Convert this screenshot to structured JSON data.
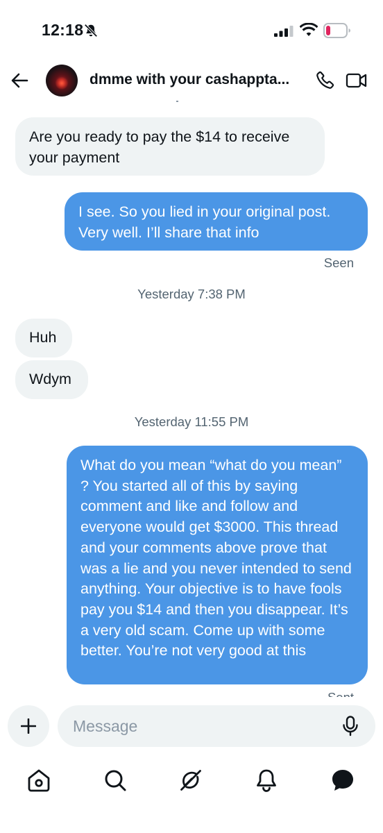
{
  "status_bar": {
    "time": "12:18",
    "icons": [
      "bell-off-icon",
      "signal-icon",
      "wifi-icon",
      "battery-icon"
    ]
  },
  "header": {
    "title": "dmme with your cashappta...",
    "icons": [
      "back-icon",
      "call-icon",
      "video-icon"
    ]
  },
  "messages": [
    {
      "direction": "incoming",
      "text": "Are you ready to pay the $14 to receive your payment"
    },
    {
      "direction": "outgoing",
      "text": "I see. So you lied in your original post. Very well. I’ll share that info"
    },
    {
      "direction": "incoming",
      "text": "Huh"
    },
    {
      "direction": "incoming",
      "text": "Wdym"
    },
    {
      "direction": "outgoing",
      "text": "What do you mean “what do you mean” ? You started all of this by saying comment and like and follow and everyone would get $3000. This thread and your comments above prove that was a lie and you never intended to send anything. Your objective is to have fools pay you $14 and then you disappear. It’s a very old scam. Come up with some better. You’re not very good at this"
    }
  ],
  "receipts": {
    "seen": "Seen",
    "sent": "Sent"
  },
  "timestamps": [
    "Yesterday 7:38 PM",
    "Yesterday 11:55 PM"
  ],
  "composer": {
    "placeholder": "Message",
    "icons": [
      "plus-icon",
      "mic-icon"
    ]
  },
  "bottom_nav": {
    "items": [
      "home-icon",
      "search-icon",
      "grok-icon",
      "notifications-icon",
      "messages-icon"
    ]
  },
  "colors": {
    "outgoing_bubble": "#4b96e6",
    "incoming_bubble": "#eff3f4",
    "text": "#0f1419",
    "muted": "#536471",
    "battery_low": "#e0245e"
  }
}
